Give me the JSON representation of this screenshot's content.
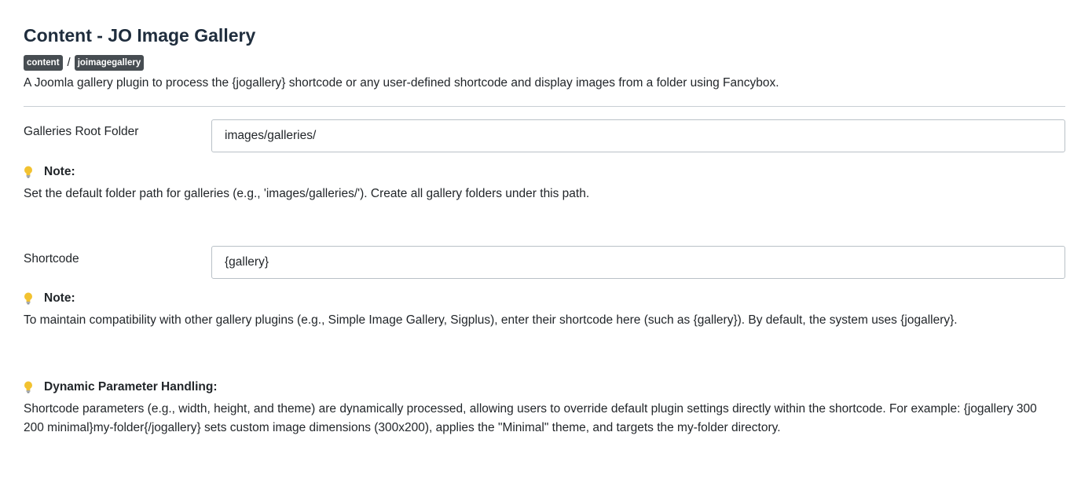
{
  "header": {
    "title": "Content - JO Image Gallery",
    "breadcrumb": [
      "content",
      "joimagegallery"
    ],
    "separator": "/",
    "description": "A Joomla gallery plugin to process the {jogallery} shortcode or any user-defined shortcode and display images from a folder using Fancybox."
  },
  "fields": {
    "root_folder": {
      "label": "Galleries Root Folder",
      "value": "images/galleries/",
      "note_title": "Note:",
      "note_text": "Set the default folder path for galleries (e.g., 'images/galleries/'). Create all gallery folders under this path."
    },
    "shortcode": {
      "label": "Shortcode",
      "value": "{gallery}",
      "note_title": "Note:",
      "note_text": "To maintain compatibility with other gallery plugins (e.g., Simple Image Gallery, Sigplus), enter their shortcode here (such as {gallery}). By default, the system uses {jogallery}."
    }
  },
  "dynamic": {
    "title": "Dynamic Parameter Handling:",
    "text": "Shortcode parameters (e.g., width, height, and theme) are dynamically processed, allowing users to override default plugin settings directly within the shortcode. For example: {jogallery 300 200 minimal}my-folder{/jogallery} sets custom image dimensions (300x200), applies the \"Minimal\" theme, and targets the my-folder directory."
  },
  "icons": {
    "note": "lightbulb-icon"
  },
  "colors": {
    "badge_bg": "#474d52",
    "title": "#1f2d3d",
    "bulb": "#f2c230"
  }
}
